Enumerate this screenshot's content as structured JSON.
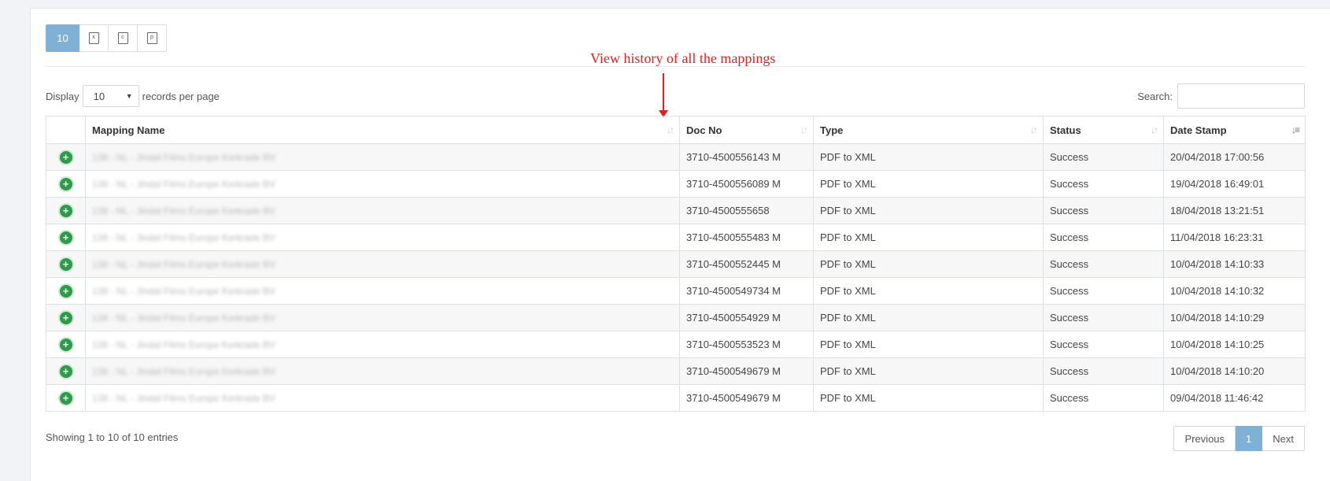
{
  "toolbar": {
    "page_size_label": "10",
    "buttons": [
      {
        "icon": "excel-icon",
        "glyph": "x"
      },
      {
        "icon": "csv-icon",
        "glyph": "c"
      },
      {
        "icon": "pdf-icon",
        "glyph": "p"
      }
    ]
  },
  "annotation": "View history of all the mappings",
  "length": {
    "prefix": "Display",
    "value": "10",
    "suffix": "records per page"
  },
  "search": {
    "label": "Search:",
    "value": ""
  },
  "table": {
    "headers": [
      "Mapping Name",
      "Doc No",
      "Type",
      "Status",
      "Date Stamp"
    ],
    "rows": [
      {
        "name": "138 - NL - Jindal Films Europe Kerkrade BV",
        "doc": "3710-4500556143 M",
        "type": "PDF to XML",
        "status": "Success",
        "date": "20/04/2018 17:00:56"
      },
      {
        "name": "138 - NL - Jindal Films Europe Kerkrade BV",
        "doc": "3710-4500556089 M",
        "type": "PDF to XML",
        "status": "Success",
        "date": "19/04/2018 16:49:01"
      },
      {
        "name": "138 - NL - Jindal Films Europe Kerkrade BV",
        "doc": "3710-4500555658",
        "type": "PDF to XML",
        "status": "Success",
        "date": "18/04/2018 13:21:51"
      },
      {
        "name": "138 - NL - Jindal Films Europe Kerkrade BV",
        "doc": "3710-4500555483 M",
        "type": "PDF to XML",
        "status": "Success",
        "date": "11/04/2018 16:23:31"
      },
      {
        "name": "138 - NL - Jindal Films Europe Kerkrade BV",
        "doc": "3710-4500552445 M",
        "type": "PDF to XML",
        "status": "Success",
        "date": "10/04/2018 14:10:33"
      },
      {
        "name": "138 - NL - Jindal Films Europe Kerkrade BV",
        "doc": "3710-4500549734 M",
        "type": "PDF to XML",
        "status": "Success",
        "date": "10/04/2018 14:10:32"
      },
      {
        "name": "138 - NL - Jindal Films Europe Kerkrade BV",
        "doc": "3710-4500554929 M",
        "type": "PDF to XML",
        "status": "Success",
        "date": "10/04/2018 14:10:29"
      },
      {
        "name": "138 - NL - Jindal Films Europe Kerkrade BV",
        "doc": "3710-4500553523 M",
        "type": "PDF to XML",
        "status": "Success",
        "date": "10/04/2018 14:10:25"
      },
      {
        "name": "138 - NL - Jindal Films Europe Kerkrade BV",
        "doc": "3710-4500549679 M",
        "type": "PDF to XML",
        "status": "Success",
        "date": "10/04/2018 14:10:20"
      },
      {
        "name": "138 - NL - Jindal Films Europe Kerkrade BV",
        "doc": "3710-4500549679 M",
        "type": "PDF to XML",
        "status": "Success",
        "date": "09/04/2018 11:46:42"
      }
    ]
  },
  "info": "Showing 1 to 10 of 10 entries",
  "pagination": {
    "previous": "Previous",
    "current": "1",
    "next": "Next"
  },
  "colors": {
    "accent": "#7fb1d6",
    "annotation": "#e32020",
    "expand": "#2f9a4b"
  }
}
